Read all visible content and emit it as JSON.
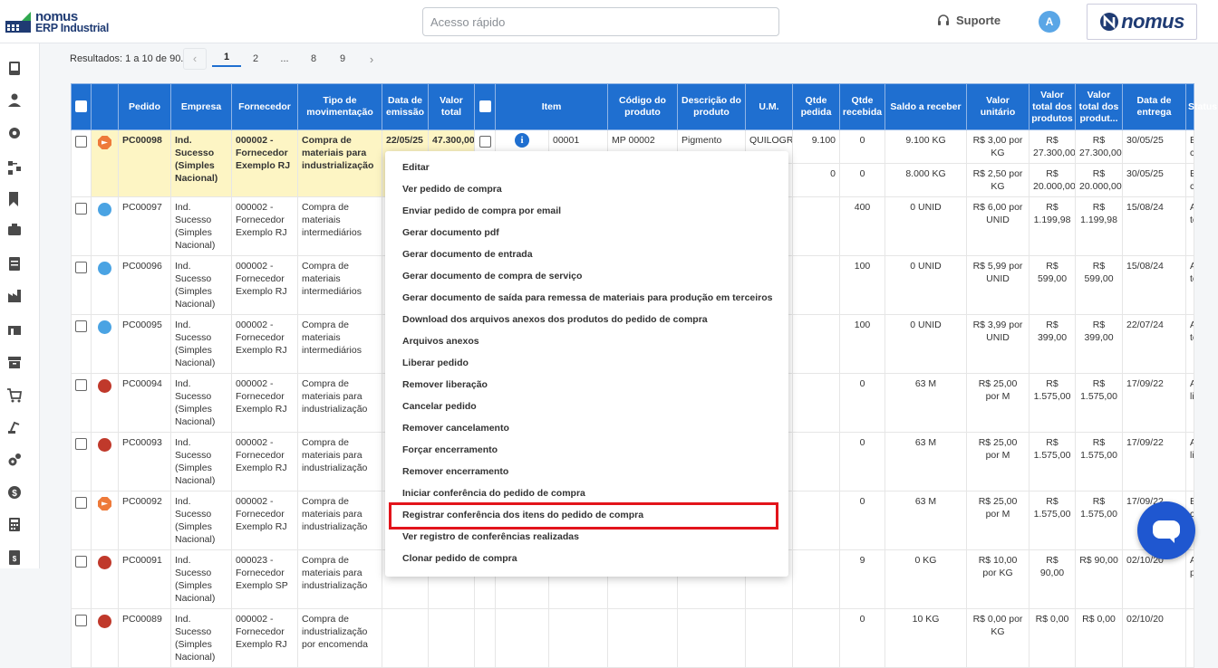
{
  "header": {
    "logo_line1": "nomus",
    "logo_line2": "ERP Industrial",
    "quick_access_placeholder": "Acesso rápido",
    "support_label": "Suporte",
    "avatar_initial": "A",
    "brand_label": "nomus"
  },
  "sidebar": {
    "icons": [
      "book-icon",
      "user-icon",
      "gear-icon",
      "flow-icon",
      "bookmark-check-icon",
      "briefcase-icon",
      "document-icon",
      "factory-icon",
      "warehouse-icon",
      "archive-icon",
      "cart-icon",
      "robot-arm-icon",
      "gears-icon",
      "dollar-icon",
      "calculator-icon",
      "invoice-icon"
    ]
  },
  "pagination": {
    "results_text": "Resultados: 1 a 10 de 90.",
    "pages": [
      "1",
      "2",
      "...",
      "8",
      "9"
    ],
    "current": "1"
  },
  "table": {
    "headers": {
      "pedido": "Pedido",
      "empresa": "Empresa",
      "fornecedor": "Fornecedor",
      "tipo": "Tipo de movimentação",
      "data_emissao": "Data de emissão",
      "valor_total": "Valor total",
      "item": "Item",
      "codigo": "Código do produto",
      "descricao": "Descrição do produto",
      "um": "U.M.",
      "qtde_pedida": "Qtde pedida",
      "qtde_recebida": "Qtde recebida",
      "saldo": "Saldo a receber",
      "valor_unitario": "Valor unitário",
      "valor_total_produtos": "Valor total dos produtos",
      "valor_total_produt": "Valor total dos produt...",
      "data_entrega": "Data de entrega",
      "status": "Status"
    },
    "rows": [
      {
        "status_icon": "orange-octagon-icon",
        "pedido": "PC00098",
        "empresa": "Ind. Sucesso (Simples Nacional)",
        "fornecedor": "000002 - Fornecedor Exemplo RJ",
        "tipo": "Compra de materiais para industrialização",
        "data_emissao": "22/05/25",
        "valor_total": "47.300,00",
        "item": "00001",
        "codigo": "MP 00002",
        "descricao": "Pigmento",
        "um": "QUILOGRAMA",
        "qtde_pedida": "9.100",
        "qtde_recebida": "0",
        "saldo": "9.100 KG",
        "valor_unitario": "R$ 3,00 por KG",
        "valor_total_produtos": "R$ 27.300,00",
        "valor_total_produt": "R$ 27.300,00",
        "data_entrega": "30/05/25",
        "status": "Em conferência"
      },
      {
        "qtde_pedida": "0",
        "qtde_recebida": "0",
        "saldo": "8.000 KG",
        "valor_unitario": "R$ 2,50 por KG",
        "valor_total_produtos": "R$ 20.000,00",
        "valor_total_produt": "R$ 20.000,00",
        "data_entrega": "30/05/25",
        "status": "Em conferência"
      },
      {
        "status_icon": "blue-dot-icon",
        "pedido": "PC00097",
        "empresa": "Ind. Sucesso (Simples Nacional)",
        "fornecedor": "000002 - Fornecedor Exemplo RJ",
        "tipo": "Compra de materiais intermediários",
        "qtde_recebida": "400",
        "saldo": "0 UNID",
        "valor_unitario": "R$ 6,00 por UNID",
        "valor_total_produtos": "R$ 1.199,98",
        "valor_total_produt": "R$ 1.199,98",
        "data_entrega": "15/08/24",
        "status": "Atendido totalmente"
      },
      {
        "status_icon": "blue-dot-icon",
        "pedido": "PC00096",
        "empresa": "Ind. Sucesso (Simples Nacional)",
        "fornecedor": "000002 - Fornecedor Exemplo RJ",
        "tipo": "Compra de materiais intermediários",
        "qtde_recebida": "100",
        "saldo": "0 UNID",
        "valor_unitario": "R$ 5,99 por UNID",
        "valor_total_produtos": "R$ 599,00",
        "valor_total_produt": "R$ 599,00",
        "data_entrega": "15/08/24",
        "status": "Atendido totalmente"
      },
      {
        "status_icon": "blue-dot-icon",
        "pedido": "PC00095",
        "empresa": "Ind. Sucesso (Simples Nacional)",
        "fornecedor": "000002 - Fornecedor Exemplo RJ",
        "tipo": "Compra de materiais intermediários",
        "qtde_recebida": "100",
        "saldo": "0 UNID",
        "valor_unitario": "R$ 3,99 por UNID",
        "valor_total_produtos": "R$ 399,00",
        "valor_total_produt": "R$ 399,00",
        "data_entrega": "22/07/24",
        "status": "Atendido totalmente"
      },
      {
        "status_icon": "red-dot-icon",
        "pedido": "PC00094",
        "empresa": "Ind. Sucesso (Simples Nacional)",
        "fornecedor": "000002 - Fornecedor Exemplo RJ",
        "tipo": "Compra de materiais para industrialização",
        "qtde_recebida": "0",
        "saldo": "63 M",
        "valor_unitario": "R$ 25,00 por M",
        "valor_total_produtos": "R$ 1.575,00",
        "valor_total_produt": "R$ 1.575,00",
        "data_entrega": "17/09/22",
        "status": "Aguardando liberação"
      },
      {
        "status_icon": "red-dot-icon",
        "pedido": "PC00093",
        "empresa": "Ind. Sucesso (Simples Nacional)",
        "fornecedor": "000002 - Fornecedor Exemplo RJ",
        "tipo": "Compra de materiais para industrialização",
        "qtde_recebida": "0",
        "saldo": "63 M",
        "valor_unitario": "R$ 25,00 por M",
        "valor_total_produtos": "R$ 1.575,00",
        "valor_total_produt": "R$ 1.575,00",
        "data_entrega": "17/09/22",
        "status": "Aguardando liberação"
      },
      {
        "status_icon": "orange-octagon-icon",
        "pedido": "PC00092",
        "empresa": "Ind. Sucesso (Simples Nacional)",
        "fornecedor": "000002 - Fornecedor Exemplo RJ",
        "tipo": "Compra de materiais para industrialização",
        "qtde_recebida": "0",
        "saldo": "63 M",
        "valor_unitario": "R$ 25,00 por M",
        "valor_total_produtos": "R$ 1.575,00",
        "valor_total_produt": "R$ 1.575,00",
        "data_entrega": "17/09/22",
        "status": "Em conferência"
      },
      {
        "status_icon": "red-dot-icon",
        "pedido": "PC00091",
        "empresa": "Ind. Sucesso (Simples Nacional)",
        "fornecedor": "000023 - Fornecedor Exemplo SP",
        "tipo": "Compra de materiais para industrialização",
        "qtde_recebida": "9",
        "saldo": "0 KG",
        "valor_unitario": "R$ 10,00 por KG",
        "valor_total_produtos": "R$ 90,00",
        "valor_total_produt": "R$ 90,00",
        "data_entrega": "02/10/20",
        "status": "Atendido parcialmente"
      },
      {
        "status_icon": "red-dot-icon",
        "pedido": "PC00089",
        "empresa": "Ind. Sucesso (Simples Nacional)",
        "fornecedor": "000002 - Fornecedor Exemplo RJ",
        "tipo": "Compra de industrialização por encomenda",
        "qtde_recebida": "0",
        "saldo": "10 KG",
        "valor_unitario": "R$ 0,00 por KG",
        "valor_total_produtos": "R$ 0,00",
        "valor_total_produt": "R$ 0,00",
        "data_entrega": "02/10/20",
        "status": ""
      }
    ]
  },
  "context_menu": {
    "items": [
      "Editar",
      "Ver pedido de compra",
      "Enviar pedido de compra por email",
      "Gerar documento pdf",
      "Gerar documento de entrada",
      "Gerar documento de compra de serviço",
      "Gerar documento de saída para remessa de materiais para produção em terceiros",
      "Download dos arquivos anexos dos produtos do pedido de compra",
      "Arquivos anexos",
      "Liberar pedido",
      "Remover liberação",
      "Cancelar pedido",
      "Remover cancelamento",
      "Forçar encerramento",
      "Remover encerramento",
      "Iniciar conferência do pedido de compra",
      "Registrar conferência dos itens do pedido de compra",
      "Ver registro de conferências realizadas",
      "Clonar pedido de compra"
    ],
    "highlighted_index": 16,
    "highlight_color": "#e2141b"
  },
  "colors": {
    "header_blue": "#1f6fd0",
    "row_highlight": "#fdf5c4",
    "status_blue": "#4aa3e3",
    "status_red": "#c0392b",
    "status_orange": "#ee7a3a",
    "chat_button": "#1f57d0"
  },
  "chat_widget": {
    "icon": "chat-bubble-icon"
  }
}
